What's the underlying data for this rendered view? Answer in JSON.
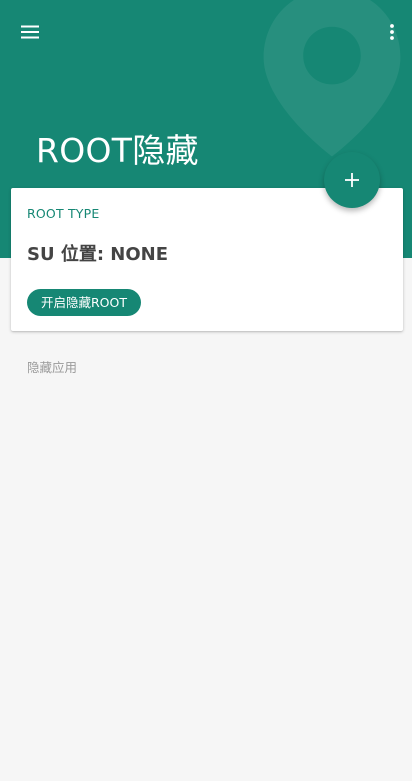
{
  "theme": {
    "accent": "#168774",
    "background": "#f6f6f6",
    "card_background": "#ffffff"
  },
  "toolbar": {
    "menu_icon": "hamburger-menu-icon",
    "more_icon": "more-vertical-icon"
  },
  "header": {
    "title": "ROOT隐藏",
    "background_icon": "location-pin-watermark-icon"
  },
  "fab": {
    "icon": "plus-icon",
    "symbol": "+"
  },
  "root_card": {
    "subtitle": "ROOT TYPE",
    "su_location": "SU 位置: NONE",
    "enable_button_label": "开启隐藏ROOT"
  },
  "hidden_apps": {
    "section_label": "隐藏应用"
  }
}
